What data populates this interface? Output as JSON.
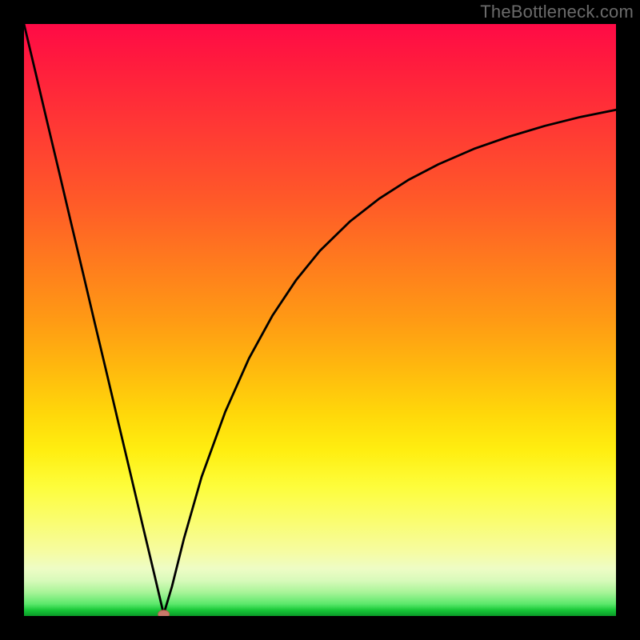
{
  "source_watermark": "TheBottleneck.com",
  "chart_data": {
    "type": "line",
    "title": "",
    "xlabel": "",
    "ylabel": "",
    "xlim": [
      0,
      100
    ],
    "ylim": [
      0,
      100
    ],
    "background_gradient": {
      "top_color": "#ff0a46",
      "mid_colors": [
        "#ff7a1e",
        "#ffd80a",
        "#f6fca0"
      ],
      "bottom_color": "#0a9a28",
      "meaning": "red=high bottleneck, green=low bottleneck"
    },
    "series": [
      {
        "name": "bottleneck-curve",
        "x": [
          0,
          2,
          4,
          6,
          8,
          10,
          12,
          14,
          16,
          18,
          20,
          22,
          23.6,
          25,
          27,
          30,
          34,
          38,
          42,
          46,
          50,
          55,
          60,
          65,
          70,
          76,
          82,
          88,
          94,
          100
        ],
        "y": [
          100,
          91.6,
          83.1,
          74.7,
          66.2,
          57.8,
          49.3,
          40.9,
          32.4,
          24.0,
          15.5,
          7.1,
          0.3,
          5.0,
          13.0,
          23.5,
          34.5,
          43.5,
          50.8,
          56.8,
          61.7,
          66.6,
          70.5,
          73.7,
          76.3,
          78.9,
          81.0,
          82.8,
          84.3,
          85.5
        ]
      }
    ],
    "marker": {
      "name": "optimal-point",
      "x": 23.6,
      "y": 0.3,
      "color": "#c97a6a"
    },
    "grid": false,
    "legend": false
  }
}
